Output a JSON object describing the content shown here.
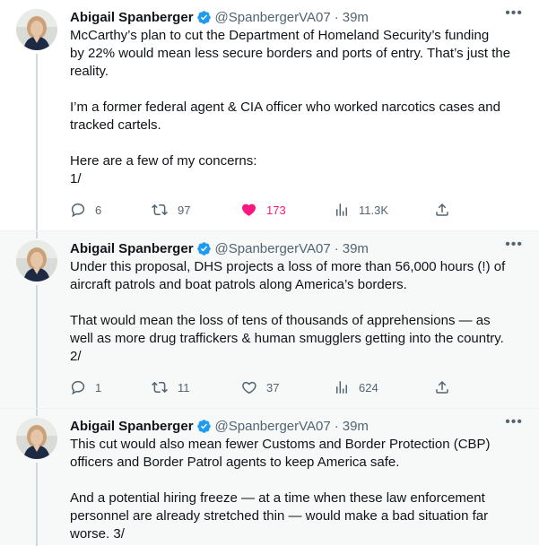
{
  "tweets": [
    {
      "name": "Abigail Spanberger",
      "handle": "@SpanbergerVA07",
      "dot": "·",
      "time": "39m",
      "paragraphs": [
        "McCarthy’s plan to cut the Department of Homeland Security’s funding\nby 22% would mean less secure borders and ports of entry. That’s just the\nreality.",
        "I’m a former federal agent & CIA officer who worked narcotics cases and\ntracked cartels.",
        "Here are a few of my concerns:\n1/"
      ],
      "replies": "6",
      "retweets": "97",
      "likes": "173",
      "views": "11.3K",
      "liked": true
    },
    {
      "name": "Abigail Spanberger",
      "handle": "@SpanbergerVA07",
      "dot": "·",
      "time": "39m",
      "paragraphs": [
        "Under this proposal, DHS projects a loss of more than 56,000 hours (!) of\naircraft patrols and boat patrols along America’s borders.",
        "That would mean the loss of tens of thousands of apprehensions — as\nwell as more drug traffickers & human smugglers getting into the country.\n2/"
      ],
      "replies": "1",
      "retweets": "11",
      "likes": "37",
      "views": "624",
      "liked": false
    },
    {
      "name": "Abigail Spanberger",
      "handle": "@SpanbergerVA07",
      "dot": "·",
      "time": "39m",
      "paragraphs": [
        "This cut would also mean fewer Customs and Border Protection (CBP)\nofficers and Border Patrol agents to keep America safe.",
        "And a potential hiring freeze —  at a time when these law enforcement\npersonnel are already stretched thin — would make a bad situation far\nworse. 3/"
      ]
    }
  ],
  "colors": {
    "text": "#0f1419",
    "muted": "#536471",
    "like": "#f91880",
    "verified": "#1d9bf0",
    "thread_line": "#cfd9de"
  },
  "icons": [
    "verified-badge-icon",
    "more-icon",
    "reply-icon",
    "retweet-icon",
    "like-icon",
    "views-icon",
    "share-icon"
  ]
}
